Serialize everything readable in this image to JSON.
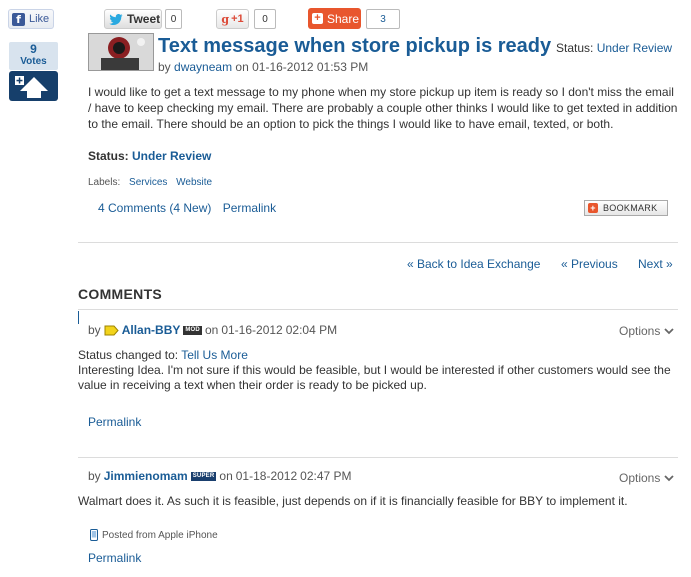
{
  "social": {
    "facebook_label": "Like",
    "tweet_label": "Tweet",
    "tweet_count": "0",
    "gplus_label": "+1",
    "gplus_count": "0",
    "share_label": "Share",
    "share_count": "3"
  },
  "vote": {
    "count": "9",
    "label": "Votes"
  },
  "post": {
    "title": "Text message when store pickup is ready",
    "status_prefix": "Status:",
    "status_value": "Under Review",
    "by_label": "by",
    "author": "dwayneam",
    "on_label": "on",
    "date": "01-16-2012",
    "time": "01:53 PM",
    "body": "I would like to get a text message to my phone when my store pickup up item is ready so I don't miss the email / have to keep checking my email.  There are probably a couple other thinks I would like to get texted in addition to the email.  There should be an option to pick the things I would like to have email, texted, or both.",
    "status_label": "Status:",
    "status_detail": "Under Review",
    "labels_title": "Labels:",
    "labels": [
      "Services",
      "Website"
    ],
    "comments_link": "4 Comments (4 New)",
    "permalink": "Permalink",
    "bookmark_label": "BOOKMARK"
  },
  "nav": {
    "back": "« Back to Idea Exchange",
    "previous": "« Previous",
    "next": "Next »"
  },
  "comments_heading": "COMMENTS",
  "comments": [
    {
      "by_label": "by",
      "author": "Allan-BBY",
      "rank": "MOD",
      "on_label": "on",
      "date": "01-16-2012",
      "time": "02:04 PM",
      "options": "Options",
      "status_changed_prefix": "Status changed to:",
      "status_changed_value": "Tell Us More",
      "body": "Interesting Idea. I'm not sure if this would be feasible, but I would be interested if other customers would see the value in receiving a text when their order is ready to be picked up.",
      "permalink": "Permalink"
    },
    {
      "by_label": "by",
      "author": "Jimmienomam",
      "rank": "SUPER",
      "on_label": "on",
      "date": "01-18-2012",
      "time": "02:47 PM",
      "options": "Options",
      "body": "Walmart does it. As such it is feasible, just depends on if it is financially feasible for BBY to implement it.",
      "posted_from": "Posted from Apple iPhone",
      "permalink": "Permalink"
    }
  ],
  "colors": {
    "link": "#1a5c96",
    "vote_button": "#163f6b",
    "share_orange": "#e8562d",
    "facebook_blue": "#3b5998"
  }
}
